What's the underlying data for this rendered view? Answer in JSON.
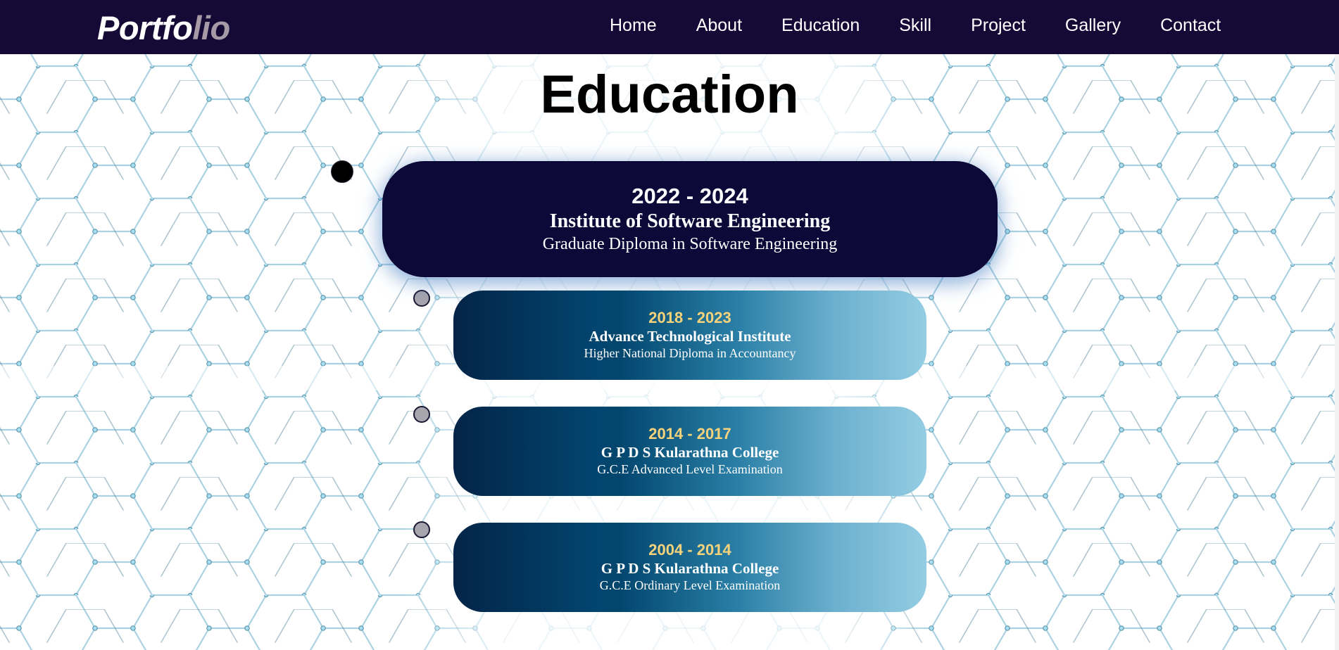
{
  "header": {
    "logo_part1": "Portfo",
    "logo_part2": "lio",
    "nav": [
      "Home",
      "About",
      "Education",
      "Skill",
      "Project",
      "Gallery",
      "Contact"
    ]
  },
  "section": {
    "title": "Education"
  },
  "education": [
    {
      "years": "2022 - 2024",
      "institution": "Institute of Software Engineering",
      "qualification": "Graduate Diploma in Software Engineering"
    },
    {
      "years": "2018 - 2023",
      "institution": "Advance Technological Institute",
      "qualification": "Higher National Diploma in Accountancy"
    },
    {
      "years": "2014 - 2017",
      "institution": "G P D S Kularathna College",
      "qualification": "G.C.E Advanced Level Examination"
    },
    {
      "years": "2004 - 2014",
      "institution": "G P D S Kularathna College",
      "qualification": "G.C.E Ordinary Level Examination"
    }
  ],
  "colors": {
    "navbar": "#150a36",
    "featured_card": "#0c0838",
    "year_highlight": "#f6d37a",
    "logo_accent": "#a69aa6"
  },
  "background_pattern": "hexagon-network"
}
